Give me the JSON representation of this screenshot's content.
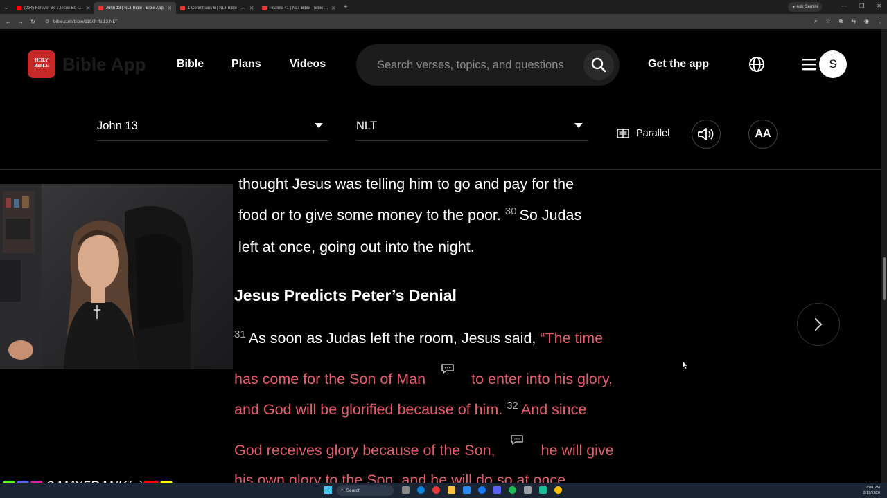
{
  "browser": {
    "tabs": [
      {
        "title": "(234) Forever Be / Jesus Be the...",
        "active": false,
        "favicon": "youtube-favicon"
      },
      {
        "title": "John 13 | NLT Bible - Bible App",
        "active": true,
        "favicon": "bible-favicon"
      },
      {
        "title": "1 Corinthians 6 | NLT Bible - Bi...",
        "active": false,
        "favicon": "bible-favicon"
      },
      {
        "title": "Psalms 41 | NLT Bible - Bible A...",
        "active": false,
        "favicon": "bible-favicon"
      }
    ],
    "gemini_label": "Ask Gemini",
    "url": "bible.com/bible/116/JHN.13.NLT"
  },
  "site": {
    "logo_text": "Bible App",
    "logo_badge": "HOLY BIBLE",
    "nav": [
      "Bible",
      "Plans",
      "Videos"
    ],
    "search_placeholder": "Search verses, topics, and questions",
    "get_app": "Get the app",
    "avatar_initial": "S"
  },
  "reader": {
    "chapter": "John 13",
    "version": "NLT",
    "parallel_label": "Parallel",
    "font_size_label": "AA"
  },
  "scripture": {
    "line1": "thought Jesus was telling him to go and pay for the",
    "line2_a": "food or to give some money to the poor.",
    "v30": "30",
    "line2_b": "So Judas",
    "line3": "left at once, going out into the night.",
    "heading": "Jesus Predicts Peter’s Denial",
    "v31": "31",
    "line4_white": "As soon as Judas left the room, Jesus said,",
    "line4_red": "“The time",
    "line5_a": "has come for the Son of Man",
    "line5_b": "to enter into his glory,",
    "line6": "and God will be glorified because of him.",
    "v32": "32",
    "line6_b": "And since",
    "line7_a": "God receives glory because of the Son,",
    "line7_b": "he will give",
    "line8": "his own glory to the Son, and he will do so at once."
  },
  "overlay": {
    "handle": "SAMXFRANK"
  },
  "taskbar": {
    "search_label": "Search",
    "time": "7:08 PM",
    "date": "8/19/2026"
  },
  "colors": {
    "words_of_jesus": "#e85d6b",
    "background": "#000000",
    "logo_red": "#c62828"
  }
}
